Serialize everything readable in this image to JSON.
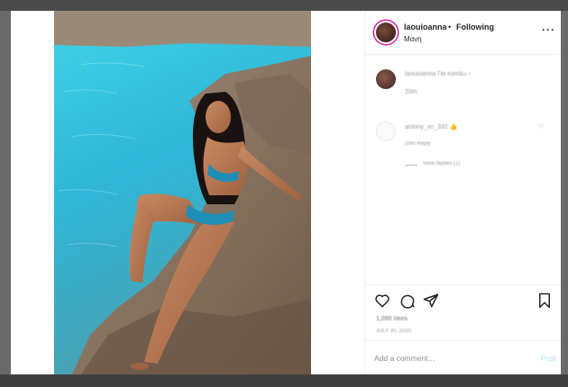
{
  "post": {
    "username": "laouioanna",
    "separator": "•",
    "follow_status": "Following",
    "location": "Μανη",
    "more_icon": "more-options-icon"
  },
  "comments": [
    {
      "username": "laouioanna",
      "text": "laouioanna Για κοιτάω ›",
      "time": "20m"
    },
    {
      "username": "antony_vn_532",
      "text": "antony_vn_332 👍",
      "meta": "20m   Reply",
      "replies": "View replies (1)"
    }
  ],
  "actions": {
    "icons": [
      "heart-icon",
      "comment-icon",
      "share-icon",
      "save-icon"
    ],
    "likes": "1,090 likes",
    "date": "JULY 30, 2020"
  },
  "composer": {
    "placeholder": "Add a comment…",
    "post_label": "Post"
  },
  "colors": {
    "accent_blue": "#0095f6",
    "disabled_post": "#b2dffc",
    "story_ring": "#d6249f"
  }
}
